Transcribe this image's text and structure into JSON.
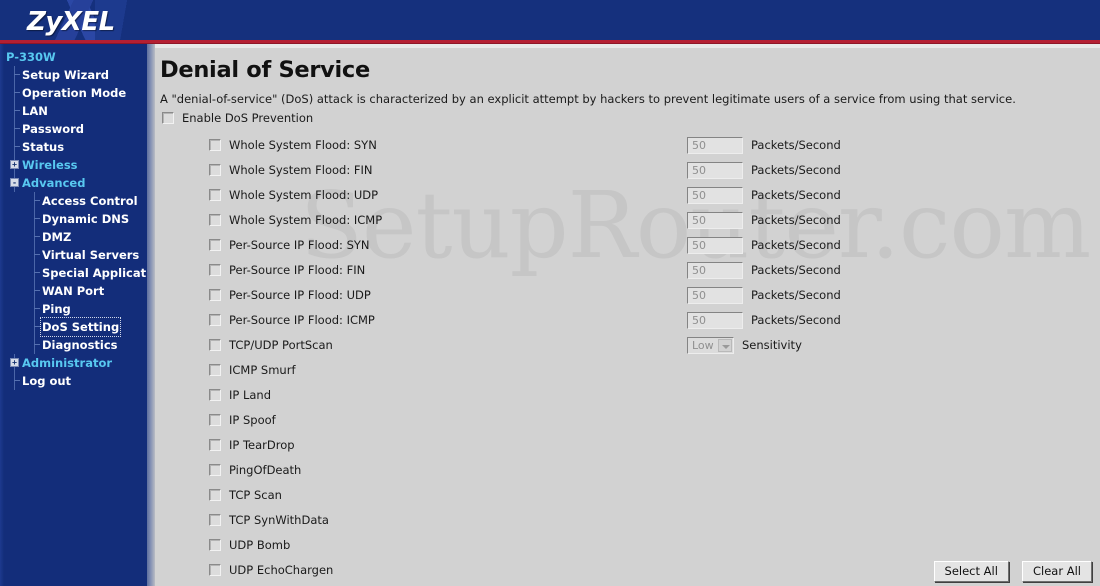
{
  "header": {
    "brand": "ZyXEL"
  },
  "sidebar": {
    "root_label": "P-330W",
    "items": [
      {
        "label": "Setup Wizard",
        "level": 1,
        "kind": "link"
      },
      {
        "label": "Operation Mode",
        "level": 1,
        "kind": "link"
      },
      {
        "label": "LAN",
        "level": 1,
        "kind": "link"
      },
      {
        "label": "Password",
        "level": 1,
        "kind": "link"
      },
      {
        "label": "Status",
        "level": 1,
        "kind": "link"
      },
      {
        "label": "Wireless",
        "level": 1,
        "kind": "group",
        "toggle": "+",
        "expanded": false
      },
      {
        "label": "Advanced",
        "level": 1,
        "kind": "group",
        "toggle": "-",
        "expanded": true
      },
      {
        "label": "Access Control",
        "level": 2,
        "kind": "link"
      },
      {
        "label": "Dynamic DNS",
        "level": 2,
        "kind": "link"
      },
      {
        "label": "DMZ",
        "level": 2,
        "kind": "link"
      },
      {
        "label": "Virtual Servers",
        "level": 2,
        "kind": "link"
      },
      {
        "label": "Special Applications",
        "level": 2,
        "kind": "link"
      },
      {
        "label": "WAN Port",
        "level": 2,
        "kind": "link"
      },
      {
        "label": "Ping",
        "level": 2,
        "kind": "link"
      },
      {
        "label": "DoS Setting",
        "level": 2,
        "kind": "link",
        "focused": true
      },
      {
        "label": "Diagnostics",
        "level": 2,
        "kind": "link"
      },
      {
        "label": "Administrator",
        "level": 1,
        "kind": "group",
        "toggle": "+",
        "expanded": false
      },
      {
        "label": "Log out",
        "level": 1,
        "kind": "link"
      }
    ]
  },
  "main": {
    "title": "Denial of Service",
    "description": "A \"denial-of-service\" (DoS) attack is characterized by an explicit attempt by hackers to prevent legitimate users of a service from using that service.",
    "watermark": "SetupRouter.com",
    "enable": {
      "label": "Enable DoS Prevention",
      "checked": false
    },
    "unit_label": "Packets/Second",
    "sensitivity_label": "Sensitivity",
    "sensitivity_value": "Low",
    "threshold_rows": [
      {
        "label": "Whole System Flood: SYN",
        "checked": false,
        "value": "50"
      },
      {
        "label": "Whole System Flood: FIN",
        "checked": false,
        "value": "50"
      },
      {
        "label": "Whole System Flood: UDP",
        "checked": false,
        "value": "50"
      },
      {
        "label": "Whole System Flood: ICMP",
        "checked": false,
        "value": "50"
      },
      {
        "label": "Per-Source IP Flood: SYN",
        "checked": false,
        "value": "50"
      },
      {
        "label": "Per-Source IP Flood: FIN",
        "checked": false,
        "value": "50"
      },
      {
        "label": "Per-Source IP Flood: UDP",
        "checked": false,
        "value": "50"
      },
      {
        "label": "Per-Source IP Flood: ICMP",
        "checked": false,
        "value": "50"
      }
    ],
    "portscan_row": {
      "label": "TCP/UDP PortScan",
      "checked": false
    },
    "simple_rows": [
      {
        "label": "ICMP Smurf",
        "checked": false
      },
      {
        "label": "IP Land",
        "checked": false
      },
      {
        "label": "IP Spoof",
        "checked": false
      },
      {
        "label": "IP TearDrop",
        "checked": false
      },
      {
        "label": "PingOfDeath",
        "checked": false
      },
      {
        "label": "TCP Scan",
        "checked": false
      },
      {
        "label": "TCP SynWithData",
        "checked": false
      },
      {
        "label": "UDP Bomb",
        "checked": false
      },
      {
        "label": "UDP EchoChargen",
        "checked": false
      }
    ],
    "buttons": {
      "select_all": "Select All",
      "clear_all": "Clear All"
    }
  },
  "colors": {
    "header_blue": "#15307d",
    "sidebar_blue": "#132d7a",
    "accent_red": "#b41f32",
    "nav_highlight": "#58c8f0",
    "content_bg": "#d2d2d2"
  }
}
